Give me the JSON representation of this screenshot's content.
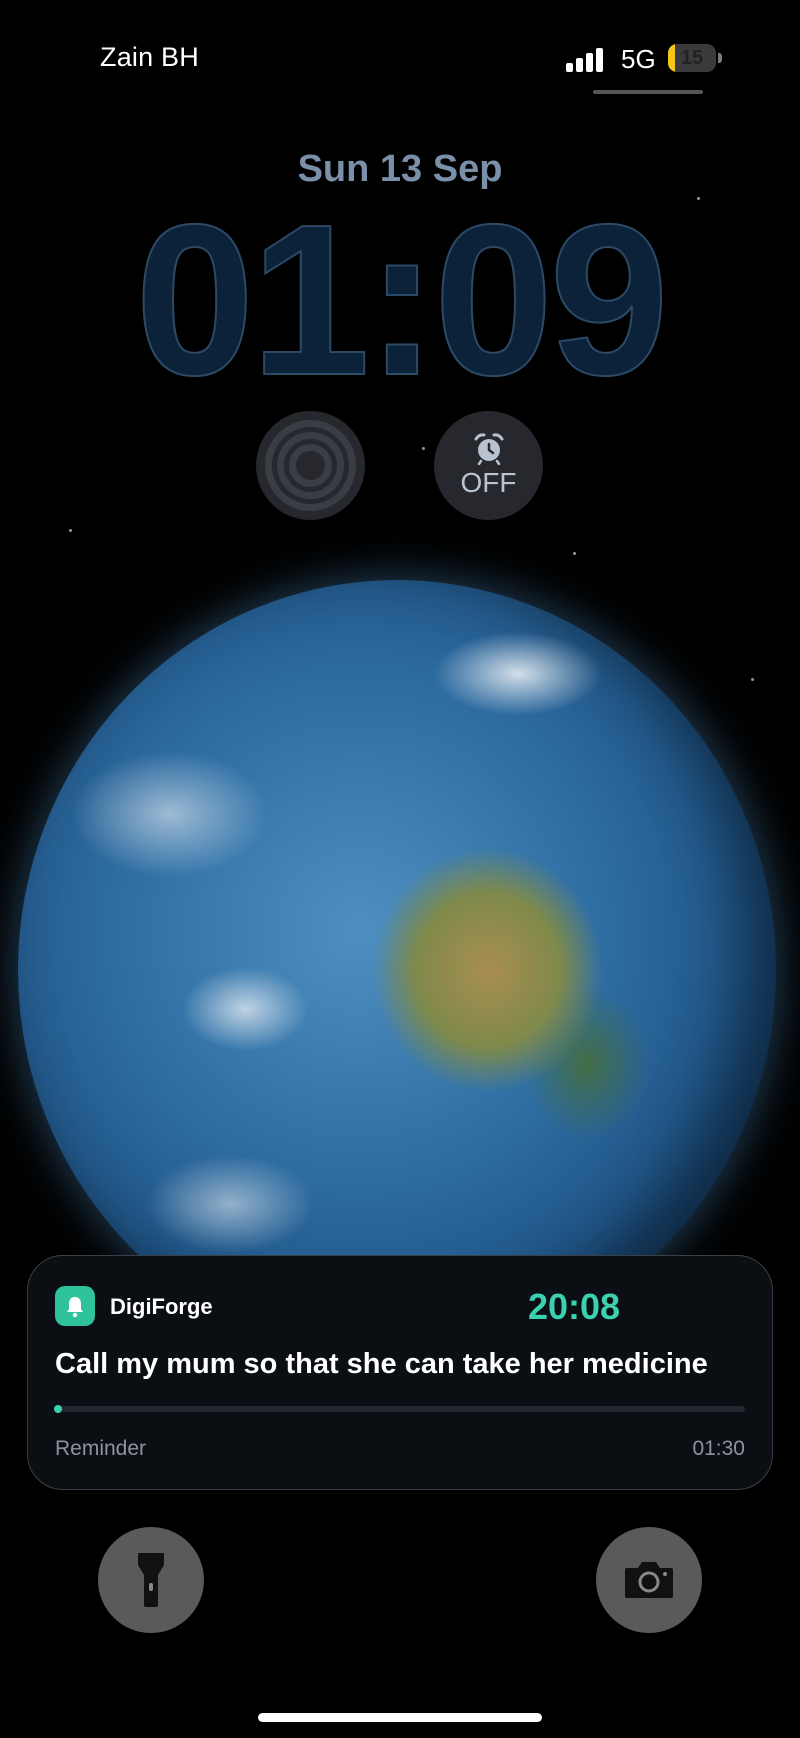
{
  "status_bar": {
    "carrier": "Zain BH",
    "network": "5G",
    "battery_level": "15",
    "battery_fraction": 0.15,
    "battery_color": "#f5c518"
  },
  "lock_screen": {
    "date": "Sun 13 Sep",
    "time": "01:09"
  },
  "widgets": {
    "activity_icon": "concentric-rings-icon",
    "alarm_icon": "alarm-clock-icon",
    "alarm_status": "OFF"
  },
  "notification": {
    "app_icon": "bell-icon",
    "app_name": "DigiForge",
    "time": "20:08",
    "message": "Call my mum so that she can take her medicine",
    "category": "Reminder",
    "duration": "01:30",
    "progress": 0.01,
    "accent_color": "#3ad0b0"
  },
  "quick_actions": {
    "left_icon": "flashlight-icon",
    "right_icon": "camera-icon"
  }
}
